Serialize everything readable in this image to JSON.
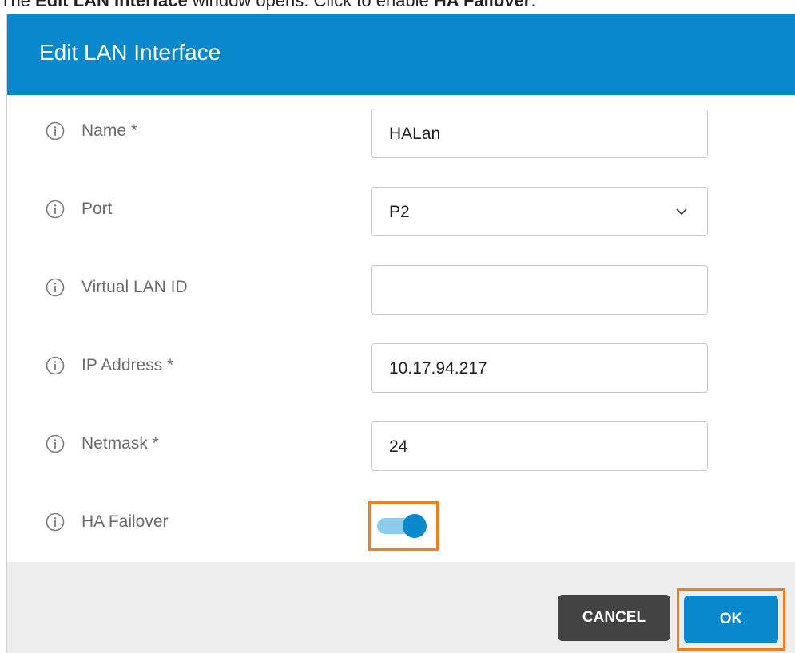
{
  "caption": {
    "prefix": "The ",
    "dialog_name": "Edit LAN Interface",
    "middle": " window opens. Click to enable ",
    "toggle_name": "HA Failover",
    "suffix": "."
  },
  "dialog": {
    "title": "Edit LAN Interface",
    "fields": [
      {
        "label": "Name *",
        "value": "HALan"
      },
      {
        "label": "Port",
        "value": "P2"
      },
      {
        "label": "Virtual LAN ID",
        "value": ""
      },
      {
        "label": "IP Address *",
        "value": "10.17.94.217"
      },
      {
        "label": "Netmask *",
        "value": "24"
      }
    ],
    "ha_failover": {
      "label": "HA Failover",
      "enabled": true
    }
  },
  "buttons": {
    "cancel": "CANCEL",
    "ok": "OK"
  },
  "colors": {
    "header": "#0a88cc",
    "highlight": "#f07f1f",
    "cancel_button": "#434343",
    "ok_button": "#0a88cc"
  },
  "icons": {
    "info": "info-icon",
    "dropdown": "chevron-down-icon"
  }
}
